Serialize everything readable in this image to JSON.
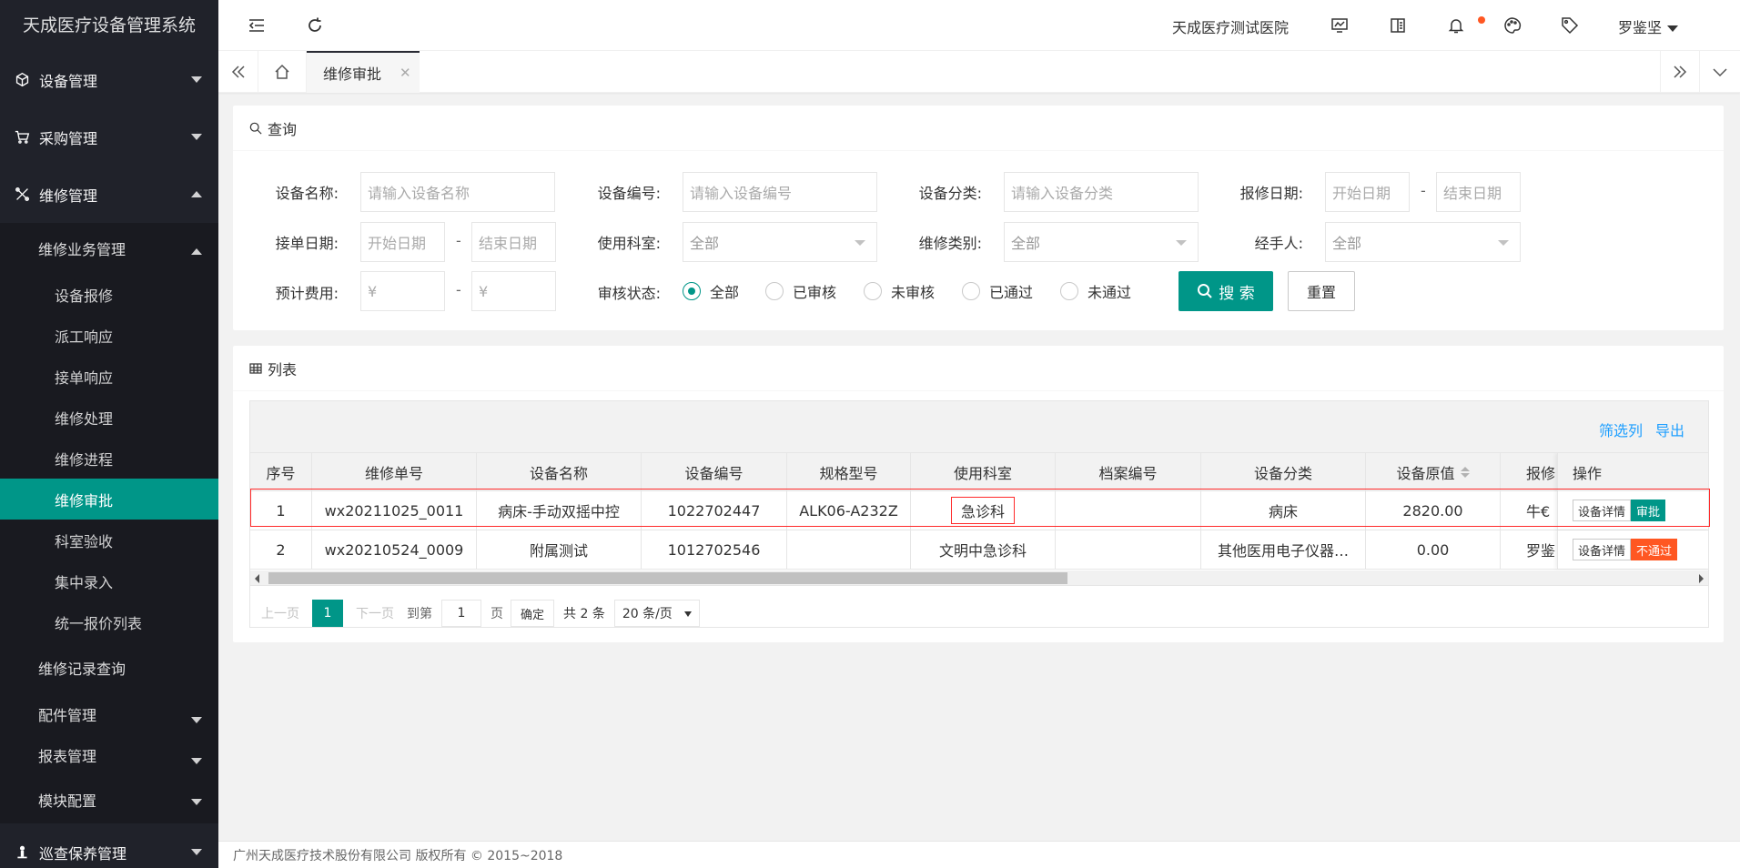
{
  "app_title": "天成医疗设备管理系统",
  "sidebar": {
    "top": [
      {
        "label": "设备管理"
      },
      {
        "label": "采购管理"
      },
      {
        "label": "维修管理"
      }
    ],
    "repair_groups": {
      "business": "维修业务管理",
      "leaves": [
        "设备报修",
        "派工响应",
        "接单响应",
        "维修处理",
        "维修进程",
        "维修审批",
        "科室验收",
        "集中录入",
        "统一报价列表"
      ],
      "record": "维修记录查询",
      "parts": "配件管理",
      "report": "报表管理",
      "module": "模块配置"
    },
    "bottom": "巡查保养管理"
  },
  "header": {
    "hospital": "天成医疗测试医院",
    "user": "罗鉴坚"
  },
  "tabs": {
    "active": "维修审批"
  },
  "query": {
    "title": "查询",
    "device_name": {
      "label": "设备名称:",
      "placeholder": "请输入设备名称"
    },
    "device_no": {
      "label": "设备编号:",
      "placeholder": "请输入设备编号"
    },
    "device_cat": {
      "label": "设备分类:",
      "placeholder": "请输入设备分类"
    },
    "report_date": {
      "label": "报修日期:",
      "start": "开始日期",
      "end": "结束日期"
    },
    "accept_date": {
      "label": "接单日期:",
      "start": "开始日期",
      "end": "结束日期"
    },
    "dept": {
      "label": "使用科室:",
      "value": "全部"
    },
    "repair_type": {
      "label": "维修类别:",
      "value": "全部"
    },
    "handler": {
      "label": "经手人:",
      "value": "全部"
    },
    "cost": {
      "label": "预计费用:",
      "min": "¥",
      "max": "¥"
    },
    "dash": "-",
    "status": {
      "label": "审核状态:",
      "options": [
        "全部",
        "已审核",
        "未审核",
        "已通过",
        "未通过"
      ],
      "selected": "全部"
    },
    "search_btn": "搜 索",
    "reset_btn": "重置"
  },
  "list": {
    "title": "列表",
    "filter_cols": "筛选列",
    "export": "导出",
    "columns": [
      "序号",
      "维修单号",
      "设备名称",
      "设备编号",
      "规格型号",
      "使用科室",
      "档案编号",
      "设备分类",
      "设备原值",
      "报修",
      "操作"
    ],
    "rows": [
      {
        "idx": "1",
        "order": "wx20211025_0011",
        "name": "病床-手动双摇中控",
        "no": "1022702447",
        "spec": "ALK06-A232Z",
        "dept": "急诊科",
        "archive": "",
        "cat": "病床",
        "value": "2820.00",
        "reporter": "牛€",
        "btn1": "设备详情",
        "btn2": "审批"
      },
      {
        "idx": "2",
        "order": "wx20210524_0009",
        "name": "附属测试",
        "no": "1012702546",
        "spec": "",
        "dept": "文明中急诊科",
        "archive": "",
        "cat": "其他医用电子仪器…",
        "value": "0.00",
        "reporter": "罗鉴",
        "btn1": "设备详情",
        "btn2": "不通过"
      }
    ]
  },
  "pager": {
    "prev": "上一页",
    "current": "1",
    "next": "下一页",
    "goto": "到第",
    "page_input": "1",
    "page_unit": "页",
    "confirm": "确定",
    "total": "共 2 条",
    "size": "20 条/页"
  },
  "footer": "广州天成医疗技术股份有限公司 版权所有 © 2015~2018",
  "colors": {
    "accent": "#009688",
    "sidebar": "#20222a",
    "danger": "#ff5722",
    "link": "#1e9fff"
  }
}
